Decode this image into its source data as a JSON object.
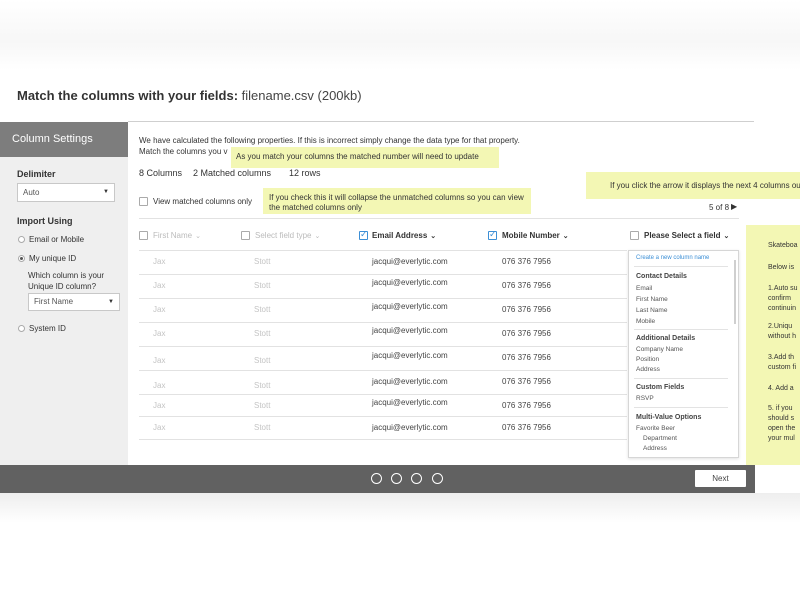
{
  "page": {
    "title_bold": "Match the columns with your fields:",
    "filename": "filename.csv (200kb)"
  },
  "sidebar": {
    "header": "Column Settings",
    "delimiter_label": "Delimiter",
    "delimiter_value": "Auto",
    "import_label": "Import Using",
    "options": [
      "Email or Mobile",
      "My unique ID",
      "System ID"
    ],
    "selected_option": "My unique ID",
    "unique_question": "Which column is your Unique ID column?",
    "unique_line1": "Which column is your",
    "unique_line2": "Unique ID column?",
    "unique_value": "First Name"
  },
  "main": {
    "intro_line1": "We have calculated the following properties. If this is incorrect simply change the data type for that property.",
    "intro_line2": "Match the columns you v",
    "columns_count": "8 Columns",
    "matched_count": "2 Matched columns",
    "rows_count": "12 rows",
    "view_matched_label": "View matched columns only",
    "pager": "5 of 8",
    "tips": {
      "matched": "As you match your columns the matched number will need to update",
      "collapse": "If you check this it will collapse the unmatched columns so you can view the matched columns only",
      "arrow": "If you click the arrow it displays the next 4 columns ou"
    },
    "headers": [
      {
        "label": "First Name",
        "checked": false
      },
      {
        "label": "Select field type",
        "checked": false
      },
      {
        "label": "Email Address",
        "checked": true
      },
      {
        "label": "Mobile Number",
        "checked": true
      },
      {
        "label": "Please Select a field",
        "checked": false
      }
    ],
    "rows": [
      [
        "Jax",
        "Stott",
        "jacqui@everlytic.com",
        "076 376 7956"
      ],
      [
        "Jax",
        "Stott",
        "jacqui@everlytic.com",
        "076 376 7956"
      ],
      [
        "Jax",
        "Stott",
        "jacqui@everlytic.com",
        "076 376 7956"
      ],
      [
        "Jax",
        "Stott",
        "jacqui@everlytic.com",
        "076 376 7956"
      ],
      [
        "Jax",
        "Stott",
        "jacqui@everlytic.com",
        "076 376 7956"
      ],
      [
        "Jax",
        "Stott",
        "jacqui@everlytic.com",
        "076 376 7956"
      ],
      [
        "Jax",
        "Stott",
        "jacqui@everlytic.com",
        "076 376 7956"
      ],
      [
        "Jax",
        "Stott",
        "jacqui@everlytic.com",
        "076 376 7956"
      ]
    ]
  },
  "dropdown": {
    "create_link": "Create a new column name",
    "groups": [
      {
        "title": "Contact Details",
        "items": [
          "Email",
          "First Name",
          "Last Name",
          "Mobile"
        ]
      },
      {
        "title": "Additional Details",
        "items": [
          "Company Name",
          "Position",
          "Address"
        ]
      },
      {
        "title": "Custom Fields",
        "items": [
          "RSVP"
        ]
      },
      {
        "title": "Multi-Value Options",
        "items": [
          "Favorite Beer",
          "Department",
          "Address"
        ]
      }
    ]
  },
  "right_note": {
    "lines": [
      "Skateboa",
      "Below is",
      "1.Auto su",
      "confirm",
      "continuin",
      "2.Uniqu",
      "without h",
      "3.Add th",
      "custom fi",
      "4. Add a",
      "5. if you",
      "should s",
      "open the",
      "your mul"
    ]
  },
  "footer": {
    "steps": 4,
    "next_label": "Next"
  },
  "colors": {
    "accent": "#3c8fd6",
    "tip": "#f3f7b4",
    "sidebar_header": "#7d7d7d",
    "footer": "#616161"
  }
}
